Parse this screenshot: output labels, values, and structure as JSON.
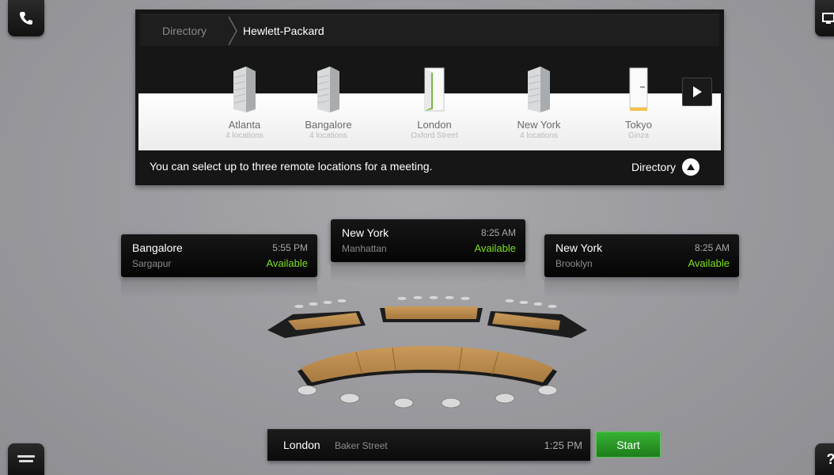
{
  "breadcrumb": {
    "root": "Directory",
    "current": "Hewlett-Packard"
  },
  "locations": [
    {
      "name": "Atlanta",
      "sub": "4 locations",
      "icon": "building-icon"
    },
    {
      "name": "Bangalore",
      "sub": "4 locations",
      "icon": "building-icon"
    },
    {
      "name": "London",
      "sub": "Oxford Street",
      "icon": "door-open-icon"
    },
    {
      "name": "New York",
      "sub": "4 locations",
      "icon": "building-icon"
    },
    {
      "name": "Tokyo",
      "sub": "Ginza",
      "icon": "door-icon"
    }
  ],
  "hint": "You can select up to three remote locations for a meeting.",
  "directory_toggle": "Directory",
  "remotes": {
    "left": {
      "city": "Bangalore",
      "area": "Sargapur",
      "time": "5:55 PM",
      "status": "Available"
    },
    "center": {
      "city": "New York",
      "area": "Manhattan",
      "time": "8:25 AM",
      "status": "Available"
    },
    "right": {
      "city": "New York",
      "area": "Brooklyn",
      "time": "8:25 AM",
      "status": "Available"
    }
  },
  "local": {
    "city": "London",
    "street": "Baker Street",
    "time": "1:25 PM"
  },
  "start_label": "Start",
  "help_label": "?",
  "colors": {
    "available": "#7de01c",
    "start": "#2e9e2b",
    "panel": "#161616"
  }
}
